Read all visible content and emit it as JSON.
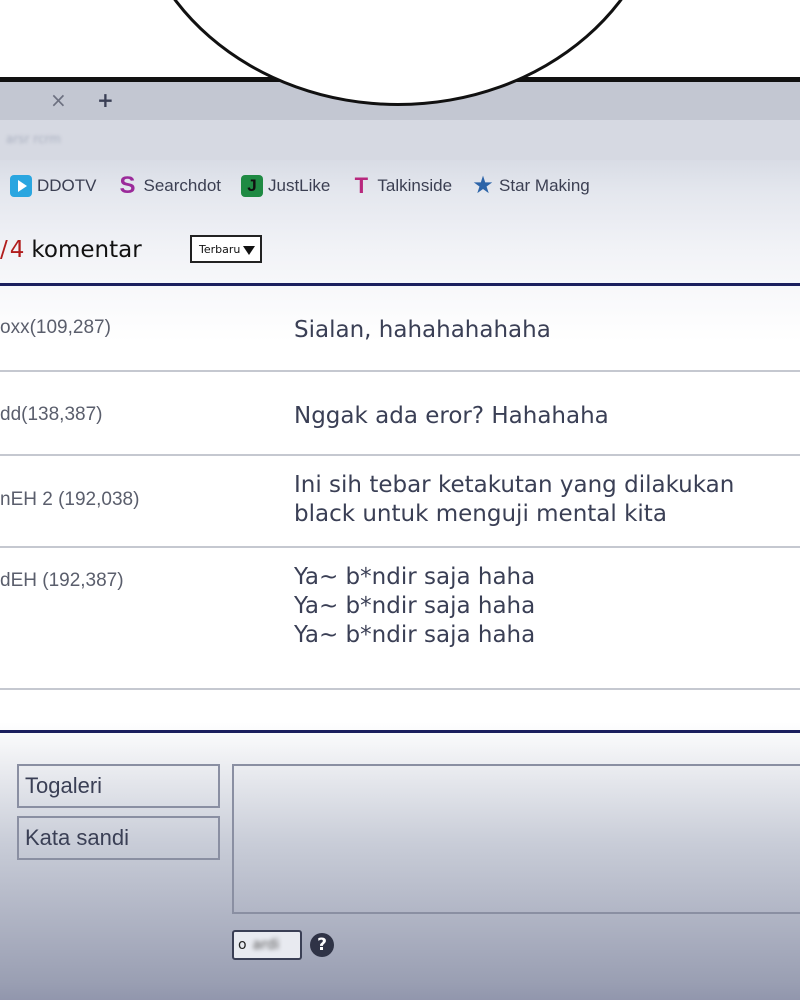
{
  "browser": {
    "tab_close": "×",
    "tab_new": "+",
    "address": "arsr rcrm"
  },
  "bookmarks": [
    {
      "label": "DDOTV",
      "icon": "ddotv-play-icon",
      "color": "#2aa6e0"
    },
    {
      "label": "Searchdot",
      "icon": "searchdot-s-icon",
      "color": "#9b2a9a"
    },
    {
      "label": "JustLike",
      "icon": "justlike-j-icon",
      "color": "#1f8a43"
    },
    {
      "label": "Talkinside",
      "icon": "talkinside-t-icon",
      "color": "#b8287d"
    },
    {
      "label": "Star Making",
      "icon": "star-icon",
      "color": "#2c64a8"
    }
  ],
  "comments_header": {
    "prefix": "/",
    "count": "4",
    "label": "komentar",
    "sort_value": "Terbaru"
  },
  "comments": [
    {
      "author": "oxx(109,287)",
      "lines": [
        "Sialan, hahahahahaha"
      ]
    },
    {
      "author": "dd(138,387)",
      "lines": [
        "Nggak ada eror? Hahahaha"
      ]
    },
    {
      "author": "nEH 2 (192,038)",
      "lines": [
        "Ini sih tebar ketakutan yang dilakukan",
        "black untuk menguji mental kita"
      ]
    },
    {
      "author": "dEH (192,387)",
      "lines": [
        "Ya~ b*ndir saja haha",
        "Ya~ b*ndir saja haha",
        "Ya~ b*ndir saja haha"
      ]
    }
  ],
  "form": {
    "name_placeholder": "Togaleri",
    "password_placeholder": "Kata sandi",
    "captcha_label": "o",
    "captcha_blur": "ardi",
    "help": "?"
  },
  "colors": {
    "accent_rule": "#1b1f5e",
    "count_red": "#b11d1d"
  }
}
